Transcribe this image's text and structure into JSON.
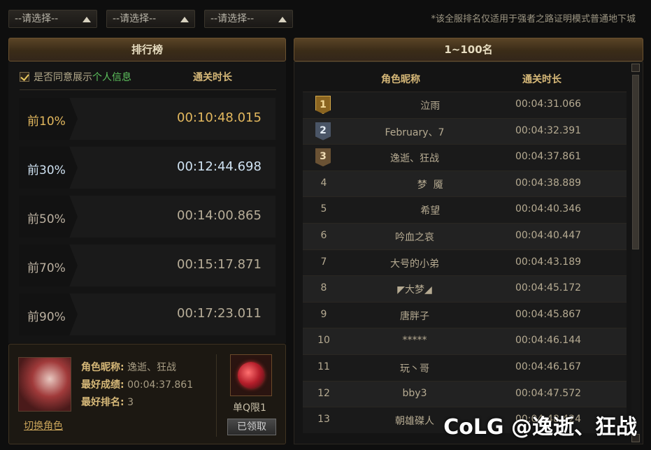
{
  "filters": [
    {
      "label": "--请选择--"
    },
    {
      "label": "--请选择--"
    },
    {
      "label": "--请选择--"
    }
  ],
  "note": "*该全服排名仅适用于强者之路证明模式普通地下城",
  "left": {
    "title": "排行榜",
    "agree_text": "是否同意展示",
    "agree_link": "个人信息",
    "time_header": "通关时长",
    "percentiles": [
      {
        "label": "前10%",
        "time": "00:10:48.015"
      },
      {
        "label": "前30%",
        "time": "00:12:44.698"
      },
      {
        "label": "前50%",
        "time": "00:14:00.865"
      },
      {
        "label": "前70%",
        "time": "00:15:17.871"
      },
      {
        "label": "前90%",
        "time": "00:17:23.011"
      }
    ]
  },
  "me": {
    "name_label": "角色昵称:",
    "name": "逸逝、狂战",
    "best_label": "最好成绩:",
    "best": "00:04:37.861",
    "rank_label": "最好排名:",
    "rank": "3",
    "switch": "切换角色",
    "reward_label": "单Q限1",
    "claimed": "已领取"
  },
  "right": {
    "title": "1~100名",
    "name_header": "角色昵称",
    "time_header": "通关时长",
    "rows": [
      {
        "rank": "1",
        "name": "          泣雨",
        "time": "00:04:31.066"
      },
      {
        "rank": "2",
        "name": "February、7",
        "time": "00:04:32.391"
      },
      {
        "rank": "3",
        "name": "逸逝、狂战",
        "time": "00:04:37.861"
      },
      {
        "rank": "4",
        "name": "          梦  魇",
        "time": "00:04:38.889"
      },
      {
        "rank": "5",
        "name": "          希望",
        "time": "00:04:40.346"
      },
      {
        "rank": "6",
        "name": "吟血之哀",
        "time": "00:04:40.447"
      },
      {
        "rank": "7",
        "name": "大号的小弟",
        "time": "00:04:43.189"
      },
      {
        "rank": "8",
        "name": "◤大梦◢",
        "time": "00:04:45.172"
      },
      {
        "rank": "9",
        "name": "唐胖子",
        "time": "00:04:45.867"
      },
      {
        "rank": "10",
        "name": "*****",
        "time": "00:04:46.144"
      },
      {
        "rank": "11",
        "name": "玩丶哥",
        "time": "00:04:46.167"
      },
      {
        "rank": "12",
        "name": "bby3",
        "time": "00:04:47.572"
      },
      {
        "rank": "13",
        "name": "朝雄磔人",
        "time": "00:04:48.424"
      }
    ]
  },
  "watermark": "CoLG @逸逝、狂战"
}
